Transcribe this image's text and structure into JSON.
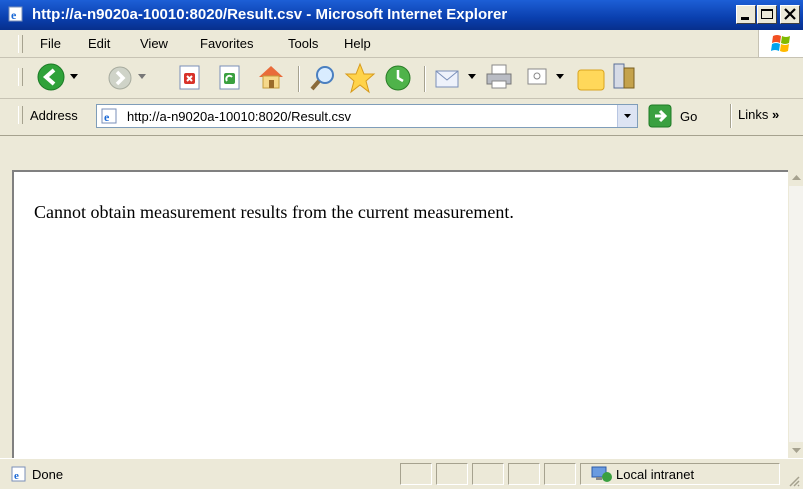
{
  "window": {
    "title": "http://a-n9020a-10010:8020/Result.csv - Microsoft Internet Explorer",
    "minimize_icon": "minimize-icon",
    "maximize_icon": "maximize-icon",
    "close_icon": "close-icon"
  },
  "menu": {
    "items": [
      {
        "label": "File"
      },
      {
        "label": "Edit"
      },
      {
        "label": "View"
      },
      {
        "label": "Favorites"
      },
      {
        "label": "Tools"
      },
      {
        "label": "Help"
      }
    ]
  },
  "toolbar": {
    "icons": [
      "back-icon",
      "forward-icon",
      "stop-icon",
      "refresh-icon",
      "home-icon",
      "search-icon",
      "favorites-icon",
      "history-icon",
      "mail-icon",
      "print-icon",
      "edit-icon",
      "folder-icon",
      "messenger-icon"
    ]
  },
  "address": {
    "label": "Address",
    "url": "http://a-n9020a-10010:8020/Result.csv",
    "go_label": "Go",
    "links_label": "Links",
    "links_chevron": "»"
  },
  "content": {
    "message": "Cannot obtain measurement results from the current measurement."
  },
  "status": {
    "text": "Done",
    "zone": "Local intranet"
  },
  "colors": {
    "titlebar": "#0a3fae",
    "chrome": "#ece9d8",
    "back_green": "#2fa23a"
  }
}
